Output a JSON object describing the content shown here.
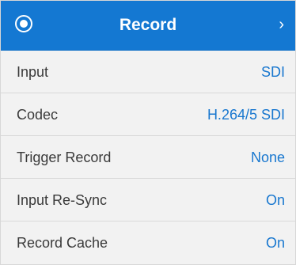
{
  "header": {
    "icon": "record-circle-icon",
    "title": "Record",
    "chevron": "›",
    "accent_color": "#1478d2"
  },
  "settings": [
    {
      "label": "Input",
      "value": "SDI"
    },
    {
      "label": "Codec",
      "value": "H.264/5 SDI"
    },
    {
      "label": "Trigger Record",
      "value": "None"
    },
    {
      "label": "Input Re-Sync",
      "value": "On"
    },
    {
      "label": "Record Cache",
      "value": "On"
    }
  ],
  "value_color": "#1877cf"
}
